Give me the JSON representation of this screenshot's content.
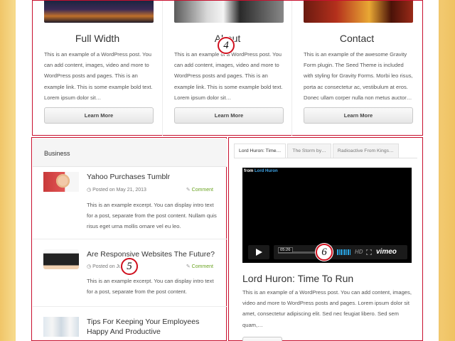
{
  "features": [
    {
      "title": "Full Width",
      "text": "This is an example of a WordPress post. You can add content, images, video and more to WordPress posts and pages. This is an example link. This is some example bold text. Lorem ipsum dolor sit…",
      "button": "Learn More"
    },
    {
      "title": "About",
      "text": "This is an example of a WordPress post. You can add content, images, video and more to WordPress posts and pages. This is an example link. This is some example bold text. Lorem ipsum dolor sit…",
      "button": "Learn More"
    },
    {
      "title": "Contact",
      "text": "This is an example of the awesome Gravity Form plugin. The Seed Theme is included with styling for Gravity Forms. Morbi leo risus, porta ac consectetur ac, vestibulum at eros. Donec ullam corper nulla non metus auctor…",
      "button": "Learn More"
    }
  ],
  "business": {
    "title": "Business",
    "posts": [
      {
        "title": "Yahoo Purchases Tumblr",
        "date": "Posted on May 21, 2013",
        "comment": "Comment",
        "excerpt": "This is an example excerpt. You can display intro text for a post, separate from the post content. Nullam quis risus eget urna mollis ornare vel eu leo."
      },
      {
        "title": "Are Responsive Websites The Future?",
        "date": "Posted on Ju…     2012",
        "comment": "Comment",
        "excerpt": "This is an example excerpt. You can display intro text for a post, separate from the post content."
      },
      {
        "title": "Tips For Keeping Your Employees Happy And Productive",
        "date": "",
        "comment": "",
        "excerpt": ""
      }
    ]
  },
  "video_widget": {
    "tabs": [
      "Lord Huron: Time…",
      "The Storm by…",
      "Radioactive From Kings…"
    ],
    "from_label": "from",
    "from_name": "Lord Huron",
    "timecode": "05:26",
    "hd": "HD",
    "brand": "vimeo",
    "title": "Lord Huron: Time To Run",
    "text": "This is an example of a WordPress post. You can add content, images, video and more to WordPress posts and pages. Lorem ipsum dolor sit amet, consectetur adipiscing elit. Sed nec feugiat libero. Sed sem quam,…"
  },
  "markers": [
    "4",
    "5",
    "6"
  ],
  "colors": {
    "callout_red": "#c8102e",
    "comment_green": "#6aa321",
    "vimeo_blue": "#2aa8e8"
  }
}
